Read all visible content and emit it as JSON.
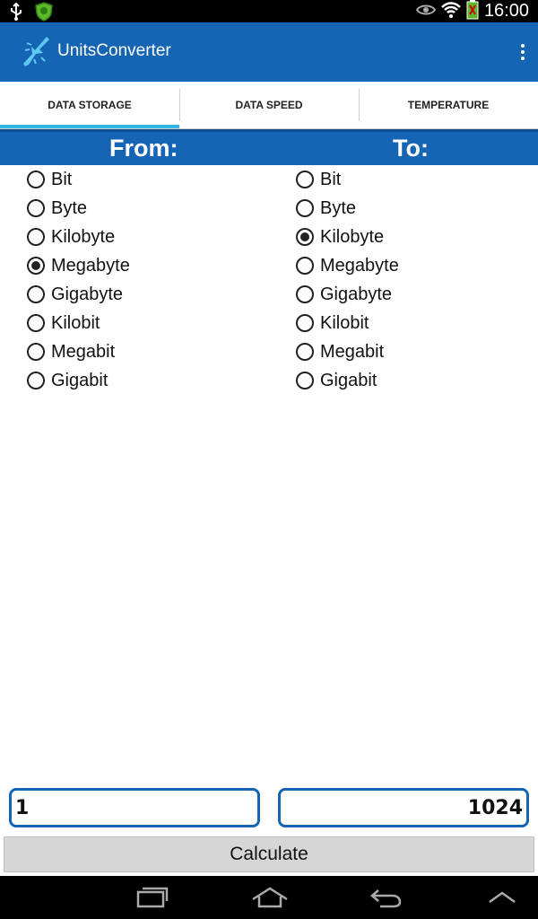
{
  "status_bar": {
    "time": "16:00",
    "icons": [
      "usb-icon",
      "shield-app-icon",
      "eye-icon",
      "wifi-icon",
      "battery-icon"
    ]
  },
  "app": {
    "title": "UnitsConverter",
    "brand_color": "#1565b4",
    "tab_indicator_color": "#33b5e5"
  },
  "tabs": [
    {
      "label": "DATA STORAGE",
      "active": true
    },
    {
      "label": "DATA SPEED",
      "active": false
    },
    {
      "label": "TEMPERATURE",
      "active": false
    }
  ],
  "header": {
    "from_label": "From:",
    "to_label": "To:"
  },
  "from_options": [
    {
      "label": "Bit",
      "checked": false
    },
    {
      "label": "Byte",
      "checked": false
    },
    {
      "label": "Kilobyte",
      "checked": false
    },
    {
      "label": "Megabyte",
      "checked": true
    },
    {
      "label": "Gigabyte",
      "checked": false
    },
    {
      "label": "Kilobit",
      "checked": false
    },
    {
      "label": "Megabit",
      "checked": false
    },
    {
      "label": "Gigabit",
      "checked": false
    }
  ],
  "to_options": [
    {
      "label": "Bit",
      "checked": false
    },
    {
      "label": "Byte",
      "checked": false
    },
    {
      "label": "Kilobyte",
      "checked": true
    },
    {
      "label": "Megabyte",
      "checked": false
    },
    {
      "label": "Gigabyte",
      "checked": false
    },
    {
      "label": "Kilobit",
      "checked": false
    },
    {
      "label": "Megabit",
      "checked": false
    },
    {
      "label": "Gigabit",
      "checked": false
    }
  ],
  "input": {
    "from_value": "1",
    "to_value": "1024"
  },
  "calculate_label": "Calculate",
  "nav_bar": {
    "icons": [
      "recent-apps-icon",
      "home-icon",
      "back-icon",
      "chevron-up-icon"
    ]
  }
}
